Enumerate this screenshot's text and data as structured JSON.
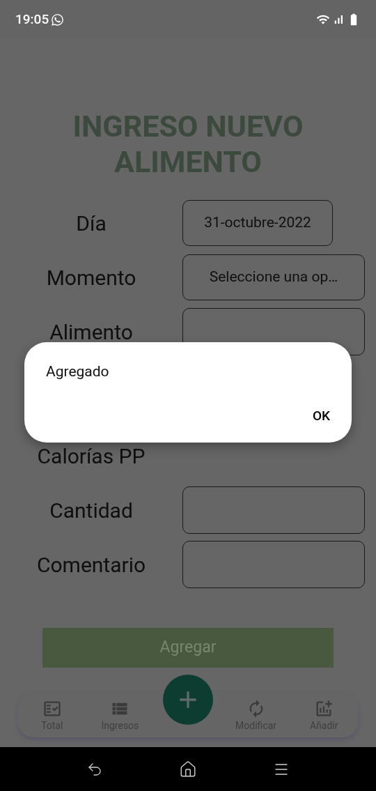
{
  "status_bar": {
    "time": "19:05"
  },
  "title": "INGRESO NUEVO ALIMENTO",
  "form": {
    "rows": [
      {
        "label": "Día",
        "kind": "date",
        "value": "31-octubre-2022"
      },
      {
        "label": "Momento",
        "kind": "select",
        "value": "Seleccione una op…"
      },
      {
        "label": "Alimento",
        "kind": "input"
      },
      {
        "kind": "hidden"
      },
      {
        "label": "Calorías PP",
        "kind": "text"
      },
      {
        "label": "Cantidad",
        "kind": "input"
      },
      {
        "label": "Comentario",
        "kind": "input"
      }
    ]
  },
  "submit_button": "Agregar",
  "bottom_nav": {
    "items": [
      {
        "label": "Total"
      },
      {
        "label": "Ingresos"
      },
      {
        "label": "Modificar"
      },
      {
        "label": "Añadir"
      }
    ]
  },
  "dialog": {
    "message": "Agregado",
    "button": "OK"
  }
}
